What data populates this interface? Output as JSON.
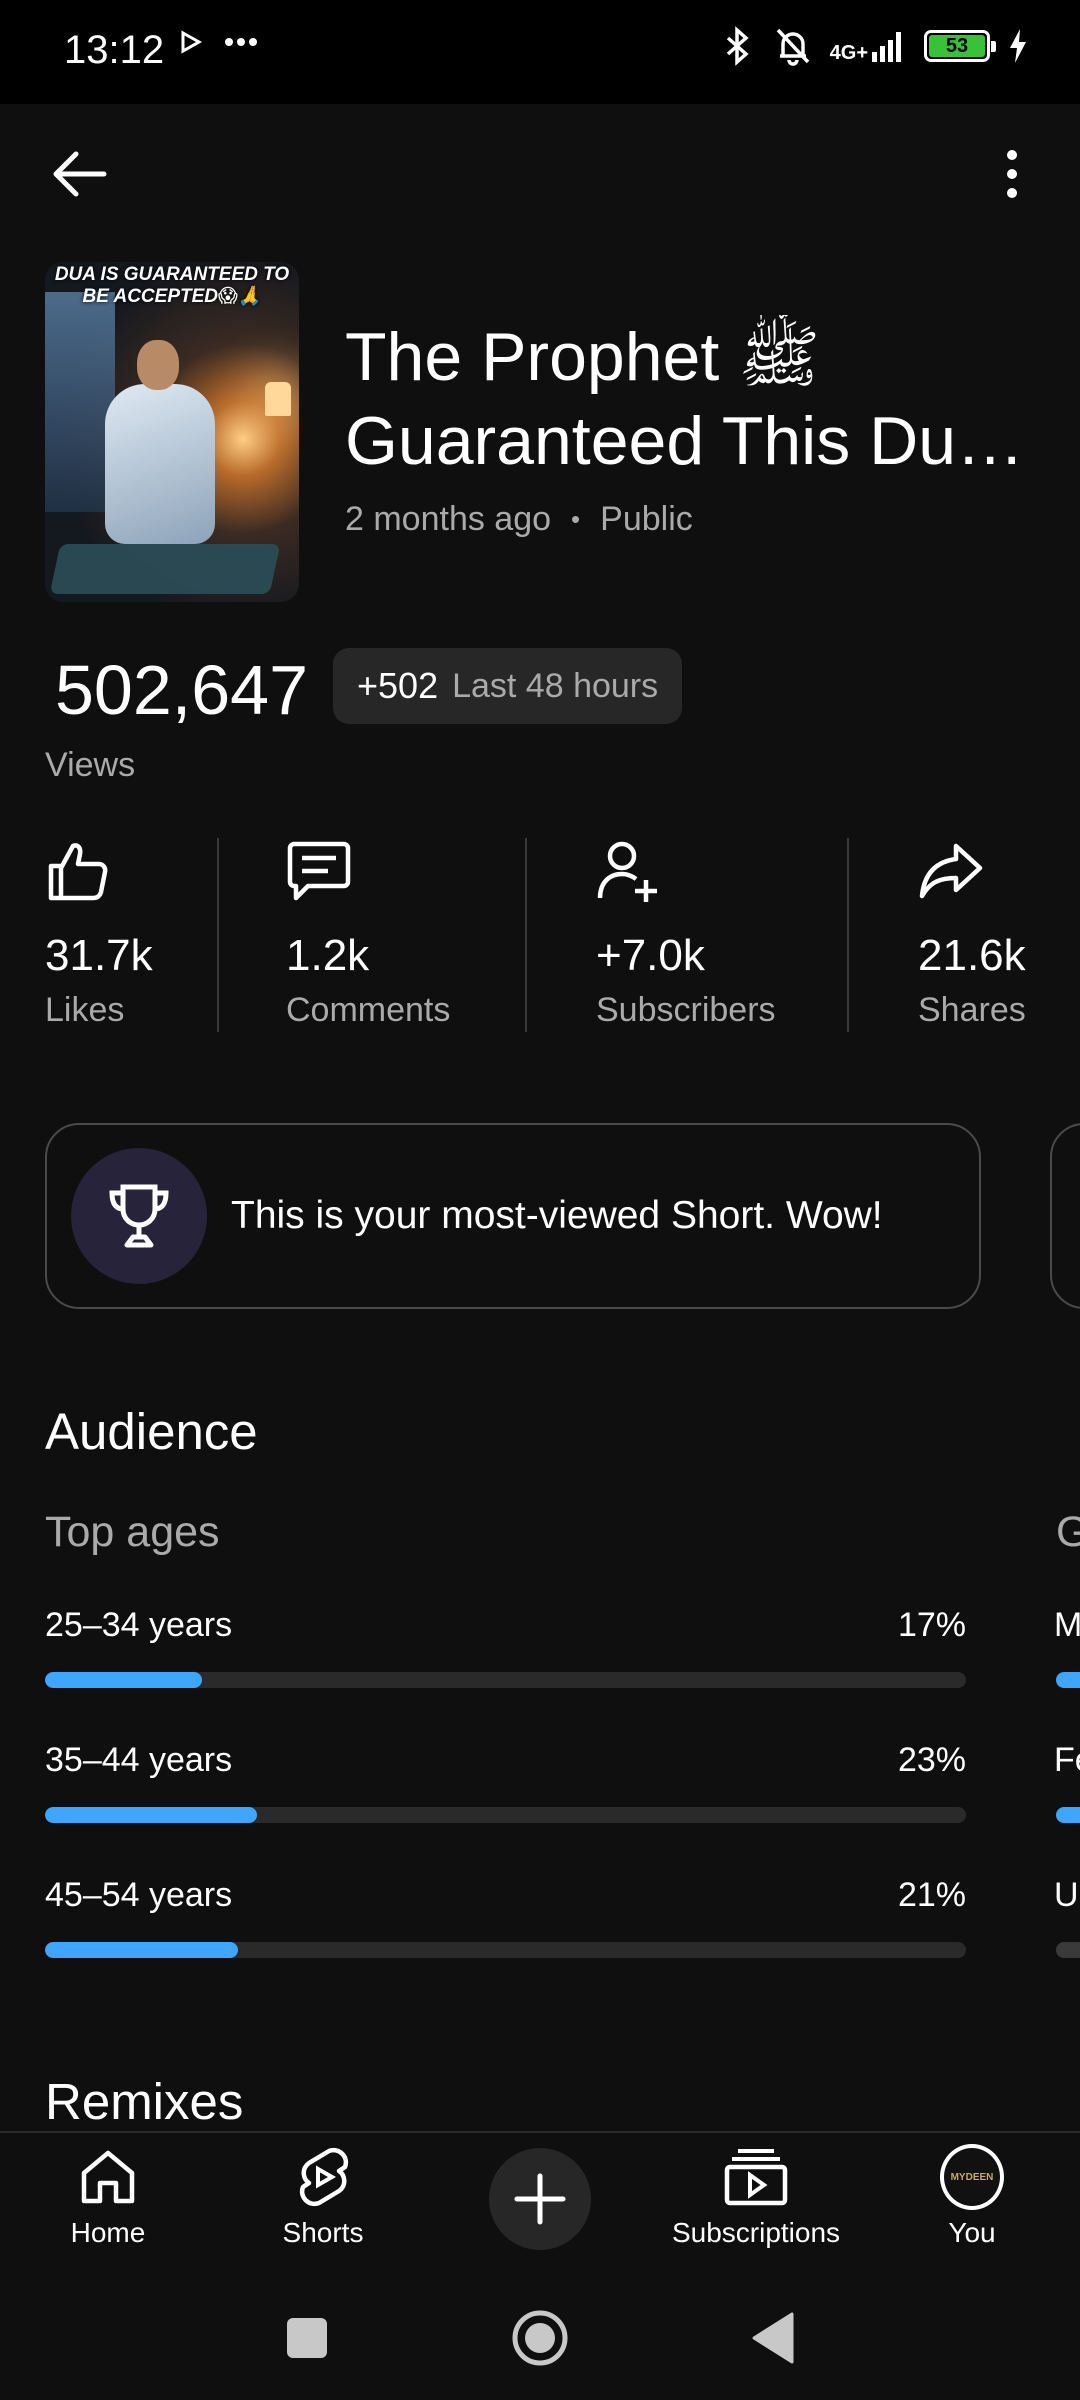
{
  "status_bar": {
    "time": "13:12",
    "network": "4G+",
    "battery": "53"
  },
  "video": {
    "thumbnail_caption": "DUA IS GUARANTEED TO BE ACCEPTED😱🙏",
    "title_line1": "The Prophet ﷺ",
    "title_line2": "Guaranteed This Du…",
    "age": "2 months ago",
    "separator": "•",
    "visibility": "Public"
  },
  "views": {
    "count": "502,647",
    "recent_change": "+502",
    "recent_label": "Last 48 hours",
    "label": "Views"
  },
  "stats": [
    {
      "icon": "thumbs-up-icon",
      "value": "31.7k",
      "label": "Likes"
    },
    {
      "icon": "comment-icon",
      "value": "1.2k",
      "label": "Comments"
    },
    {
      "icon": "add-person-icon",
      "value": "+7.0k",
      "label": "Subscribers"
    },
    {
      "icon": "share-icon",
      "value": "21.6k",
      "label": "Shares"
    }
  ],
  "milestone": {
    "icon": "trophy-icon",
    "text": "This is your most-viewed Short. Wow!"
  },
  "audience": {
    "title": "Audience",
    "top_ages_title": "Top ages",
    "next_card_title_peek": "G",
    "ages": [
      {
        "label": "25–34 years",
        "percent": "17%",
        "fraction": 0.17
      },
      {
        "label": "35–44 years",
        "percent": "23%",
        "fraction": 0.23
      },
      {
        "label": "45–54 years",
        "percent": "21%",
        "fraction": 0.21
      }
    ],
    "next_card_labels_peek": [
      "M",
      "Fe",
      "U"
    ]
  },
  "remixes_title": "Remixes",
  "bottom_nav": {
    "items": [
      {
        "icon": "home-icon",
        "label": "Home"
      },
      {
        "icon": "shorts-icon",
        "label": "Shorts"
      },
      {
        "icon": "plus-icon",
        "label": ""
      },
      {
        "icon": "subscriptions-icon",
        "label": "Subscriptions"
      },
      {
        "icon": "avatar",
        "label": "You"
      }
    ],
    "avatar_text": "MYDEEN"
  },
  "colors": {
    "background": "#0f0f0f",
    "accent": "#3ea6ff",
    "muted_text": "#aaaaaa",
    "chip": "#272727"
  }
}
